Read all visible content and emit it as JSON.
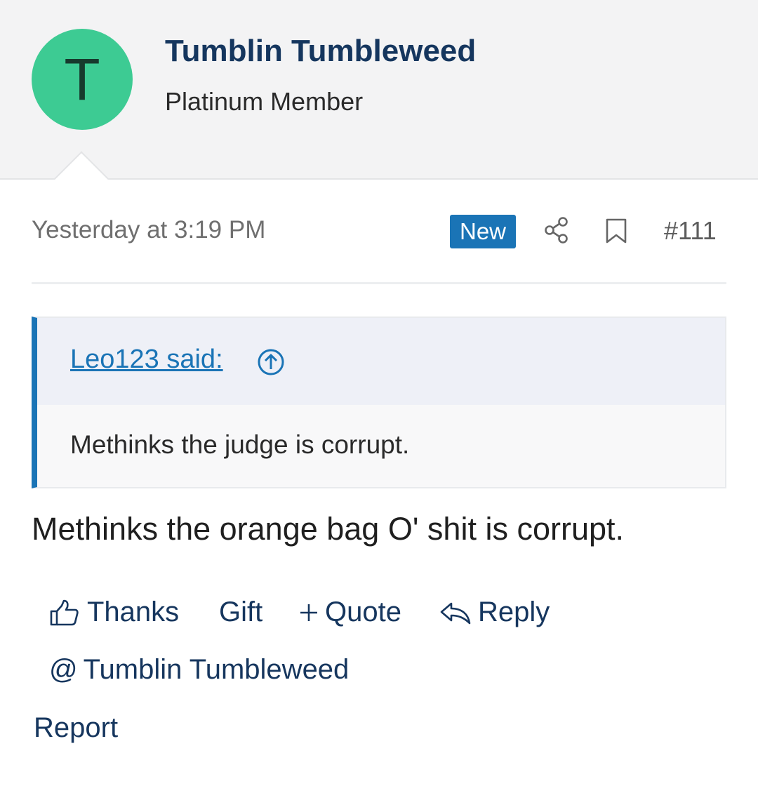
{
  "author": {
    "avatar_letter": "T",
    "name": "Tumblin Tumbleweed",
    "title": "Platinum Member",
    "avatar_color": "#3dcb93"
  },
  "meta": {
    "timestamp": "Yesterday at 3:19 PM",
    "badge": "New",
    "badge_color": "#1a74b6",
    "share_icon": "share-icon",
    "bookmark_icon": "bookmark-icon",
    "post_number": "#111"
  },
  "quote": {
    "author_label": "Leo123 said:",
    "goto_icon": "arrow-up-circle-icon",
    "text": "Methinks the judge is corrupt.",
    "accent_color": "#1a74b6"
  },
  "post": {
    "body": "Methinks the orange bag O' shit is corrupt."
  },
  "actions": {
    "thanks": "Thanks",
    "gift": "Gift",
    "quote": "Quote",
    "reply": "Reply",
    "mention": "Tumblin Tumbleweed",
    "report": "Report"
  }
}
